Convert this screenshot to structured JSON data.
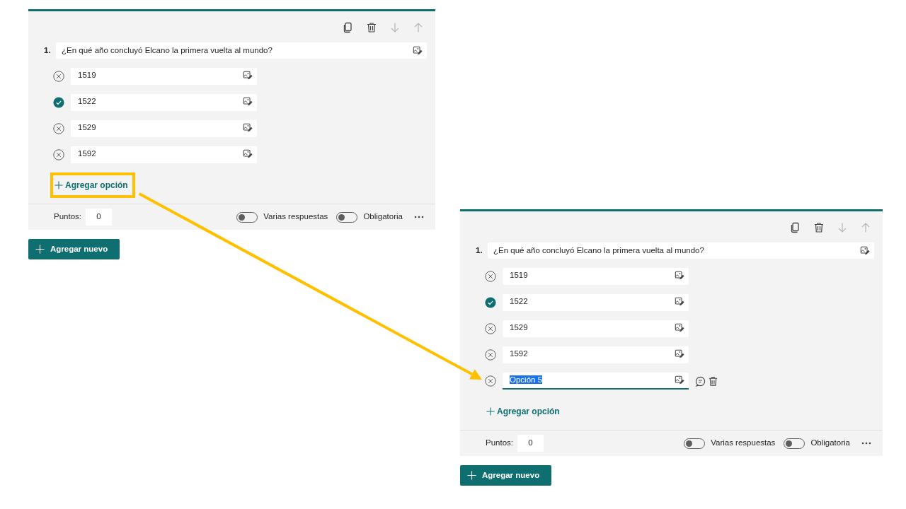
{
  "panels": [
    {
      "question_number": "1.",
      "question": "¿En qué año concluyó Elcano la primera vuelta al mundo?",
      "options": [
        {
          "text": "1519",
          "correct": false,
          "editing": false
        },
        {
          "text": "1522",
          "correct": true,
          "editing": false
        },
        {
          "text": "1529",
          "correct": false,
          "editing": false
        },
        {
          "text": "1592",
          "correct": false,
          "editing": false
        }
      ],
      "add_option": {
        "label": "Agregar opción",
        "highlighted": true
      },
      "points_label": "Puntos:",
      "points": "0",
      "toggles": [
        {
          "label": "Varias respuestas",
          "on": false
        },
        {
          "label": "Obligatoria",
          "on": false
        }
      ],
      "add_new": "Agregar nuevo"
    },
    {
      "question_number": "1.",
      "question": "¿En qué año concluyó Elcano la primera vuelta al mundo?",
      "options": [
        {
          "text": "1519",
          "correct": false,
          "editing": false
        },
        {
          "text": "1522",
          "correct": true,
          "editing": false
        },
        {
          "text": "1529",
          "correct": false,
          "editing": false
        },
        {
          "text": "1592",
          "correct": false,
          "editing": false
        },
        {
          "text": "Opción 5",
          "correct": false,
          "editing": true
        }
      ],
      "add_option": {
        "label": "Agregar opción",
        "highlighted": false
      },
      "points_label": "Puntos:",
      "points": "0",
      "toggles": [
        {
          "label": "Varias respuestas",
          "on": false
        },
        {
          "label": "Obligatoria",
          "on": false
        }
      ],
      "add_new": "Agregar nuevo"
    }
  ]
}
